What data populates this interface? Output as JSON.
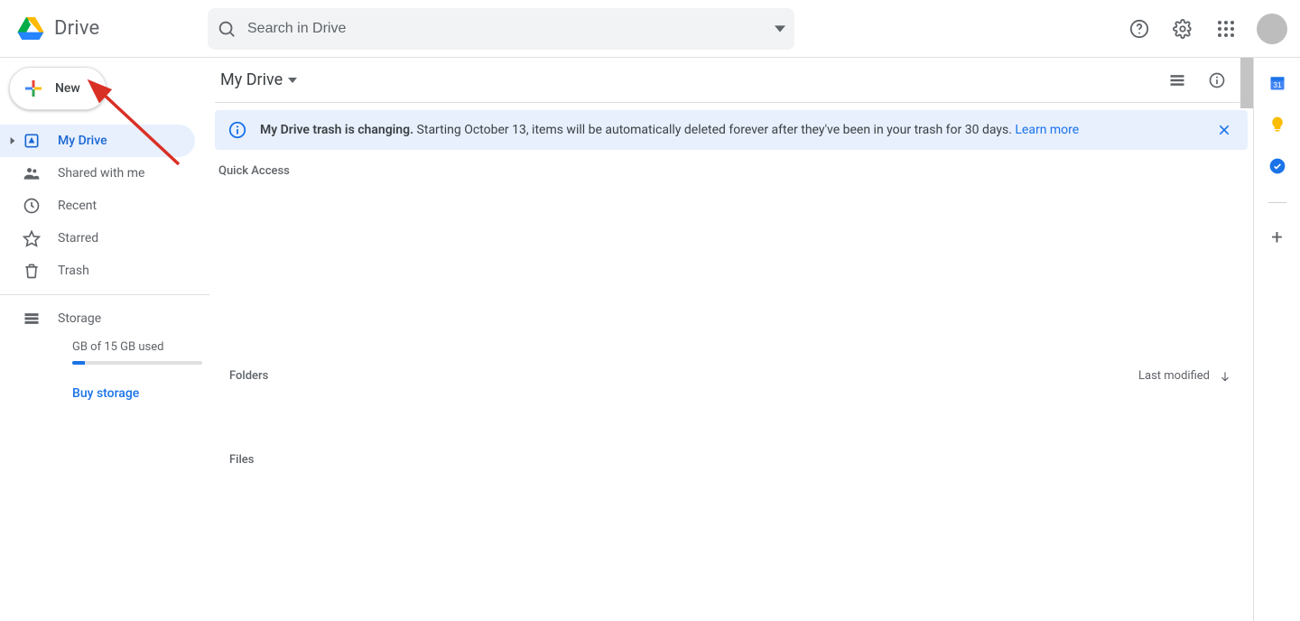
{
  "brand": {
    "name": "Drive"
  },
  "search": {
    "placeholder": "Search in Drive"
  },
  "sidebar": {
    "new_label": "New",
    "items": {
      "mydrive": "My Drive",
      "shared": "Shared with me",
      "recent": "Recent",
      "starred": "Starred",
      "trash": "Trash"
    },
    "storage_label": "Storage",
    "storage_text": "GB of 15 GB used",
    "buy_storage": "Buy storage"
  },
  "main": {
    "breadcrumb": "My Drive",
    "banner": {
      "bold": "My Drive trash is changing.",
      "text": "Starting October 13, items will be automatically deleted forever after they've been in your trash for 30 days.",
      "link": "Learn more"
    },
    "quick_access": "Quick Access",
    "folders": "Folders",
    "sort_label": "Last modified",
    "files": "Files"
  }
}
